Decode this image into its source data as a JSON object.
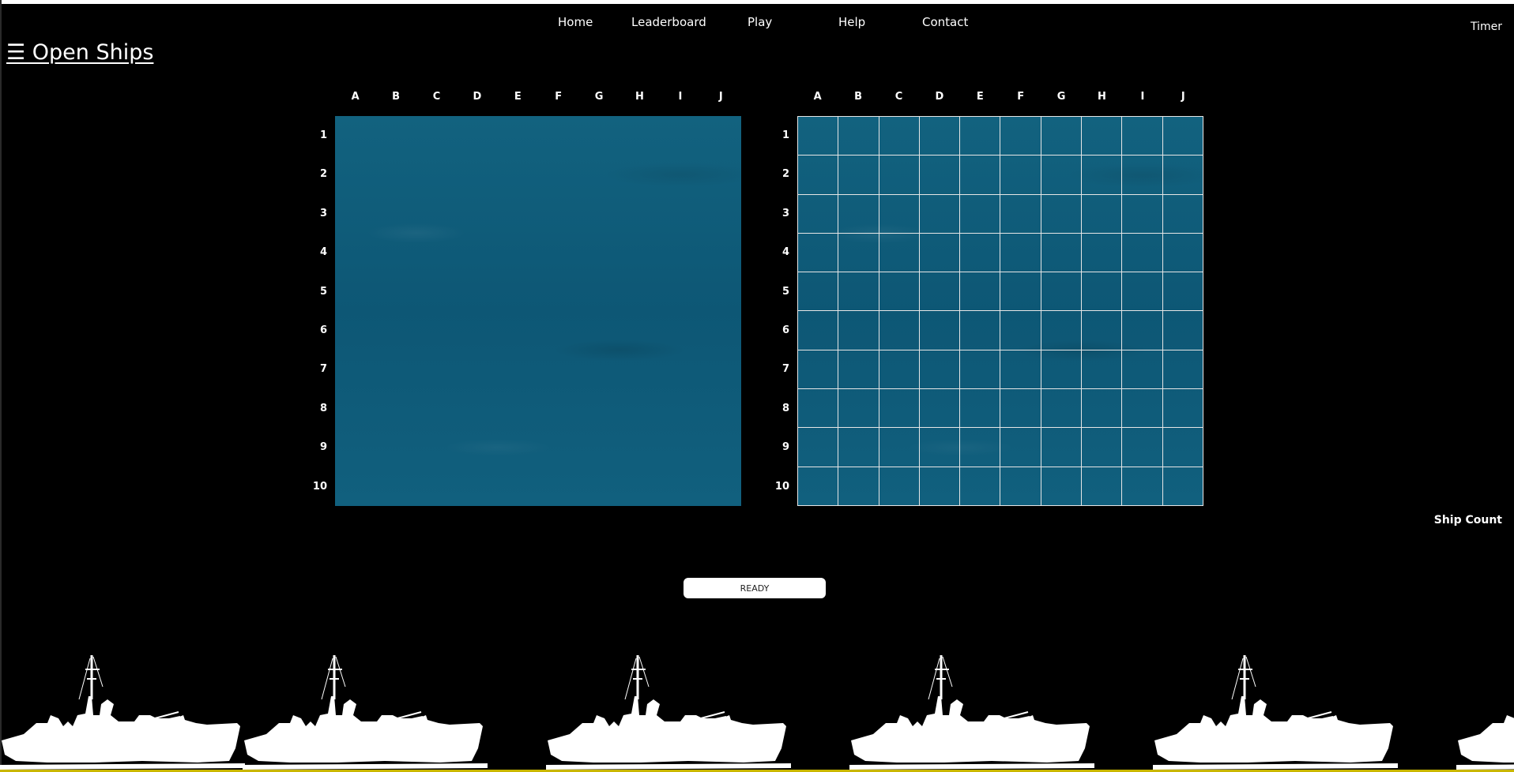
{
  "nav": {
    "items": [
      {
        "label": "Home"
      },
      {
        "label": "Leaderboard"
      },
      {
        "label": "Play"
      },
      {
        "label": "Help"
      },
      {
        "label": "Contact"
      }
    ]
  },
  "menu": {
    "label": "☰ Open Ships"
  },
  "timer": {
    "label": "Timer"
  },
  "ship_count": {
    "label": "Ship Count"
  },
  "boards": {
    "columns": [
      "A",
      "B",
      "C",
      "D",
      "E",
      "F",
      "G",
      "H",
      "I",
      "J"
    ],
    "rows": [
      "1",
      "2",
      "3",
      "4",
      "5",
      "6",
      "7",
      "8",
      "9",
      "10"
    ]
  },
  "actions": {
    "ready_label": "READY"
  },
  "colors": {
    "background": "#000000",
    "water": "#0f5d7d",
    "grid_lines": "#e6e6e6",
    "silhouette": "#ffffff",
    "bottom_border": "#c9b600"
  }
}
